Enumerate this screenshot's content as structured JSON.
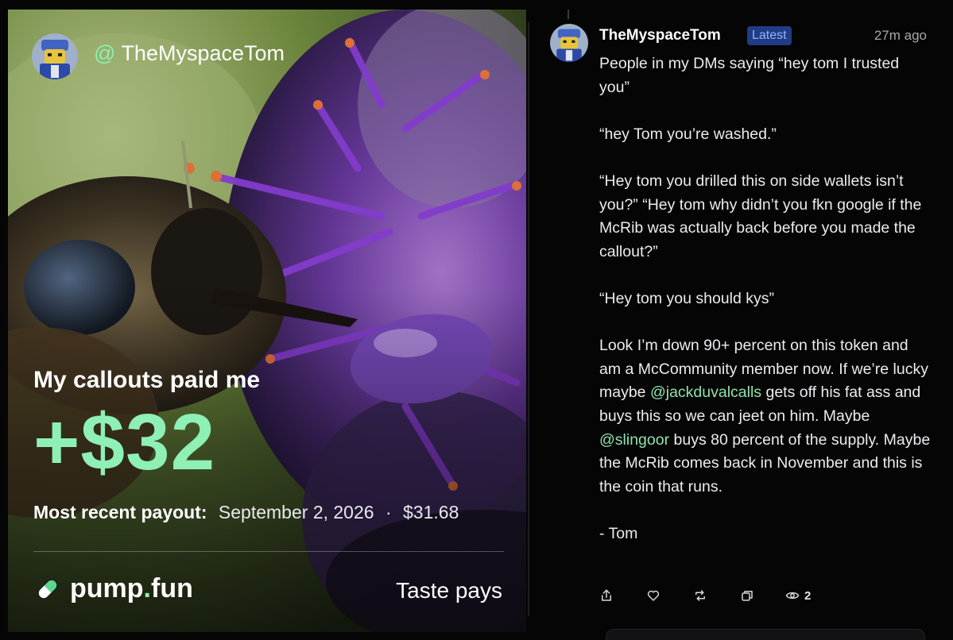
{
  "card": {
    "handle_at": "@",
    "handle": "TheMyspaceTom",
    "headline": "My callouts paid me",
    "amount": "+$32",
    "payout_label": "Most recent payout:",
    "payout_date": "September 2, 2026",
    "payout_separator": "·",
    "payout_value": "$31.68",
    "brand_name": "pump",
    "brand_dot": ".",
    "brand_suffix": "fun",
    "tagline": "Taste pays",
    "accent_color": "#8ef0b4"
  },
  "post": {
    "username": "TheMyspaceTom",
    "badge": "Latest",
    "time": "27m ago",
    "lines": {
      "p1": "People in my DMs saying “hey tom I trusted you”",
      "p2": "“hey Tom you’re washed.”",
      "p3": "“Hey tom you drilled this on side wallets isn’t you?” “Hey tom why didn’t you fkn google if the McRib was actually back before you made the callout?”",
      "p4": "“Hey tom you should kys”",
      "p5_a": "Look I’m down 90+ percent on this token and am a McCommunity member now. If we’re lucky maybe ",
      "p5_mention1": "@jackduvalcalls",
      "p5_b": " gets off his fat ass and buys this so we can jeet on him. Maybe ",
      "p5_mention2": "@slingoor",
      "p5_c": " buys 80 percent of the supply. Maybe the McRib comes back in November and this is the coin that runs.",
      "p6": "- Tom"
    },
    "mention_color": "#8ee3a8",
    "badge_color": "#213c84"
  },
  "actions": {
    "share_icon": "share-icon",
    "like_icon": "heart-icon",
    "repost_icon": "repost-icon",
    "copy_icon": "copy-icon",
    "views_icon": "eye-icon",
    "views_count": "2"
  }
}
